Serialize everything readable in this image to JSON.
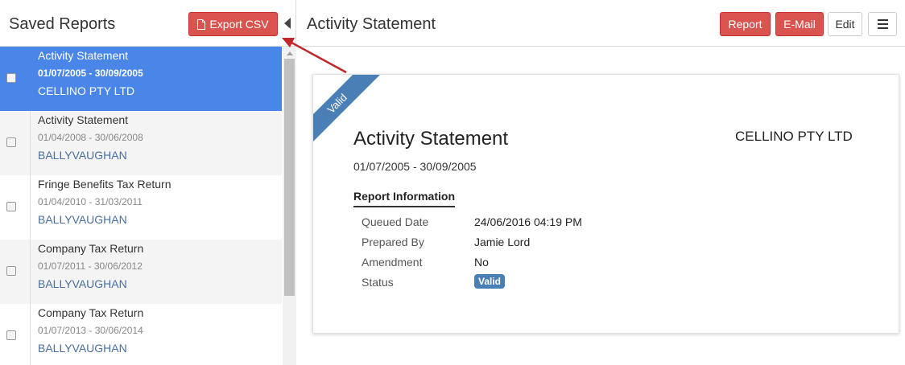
{
  "left_pane": {
    "title": "Saved Reports",
    "export_label": "Export CSV",
    "export_icon": "file-icon",
    "collapse_icon": "caret-left-icon"
  },
  "reports": [
    {
      "name": "Activity Statement",
      "period": "01/07/2005 - 30/09/2005",
      "entity": "CELLINO PTY LTD",
      "selected": true
    },
    {
      "name": "Activity Statement",
      "period": "01/04/2008 - 30/06/2008",
      "entity": "BALLYVAUGHAN",
      "selected": false
    },
    {
      "name": "Fringe Benefits Tax Return",
      "period": "01/04/2010 - 31/03/2011",
      "entity": "BALLYVAUGHAN",
      "selected": false
    },
    {
      "name": "Company Tax Return",
      "period": "01/07/2011 - 30/06/2012",
      "entity": "BALLYVAUGHAN",
      "selected": false
    },
    {
      "name": "Company Tax Return",
      "period": "01/07/2013 - 30/06/2014",
      "entity": "BALLYVAUGHAN",
      "selected": false
    }
  ],
  "right_pane": {
    "title": "Activity Statement",
    "buttons": {
      "report": "Report",
      "email": "E-Mail",
      "edit": "Edit"
    },
    "menu_icon": "hamburger-icon"
  },
  "card": {
    "ribbon": "Valid",
    "title": "Activity Statement",
    "entity": "CELLINO PTY LTD",
    "period": "01/07/2005 - 30/09/2005",
    "section_title": "Report Information",
    "info": [
      {
        "label": "Queued Date",
        "value": "24/06/2016 04:19 PM"
      },
      {
        "label": "Prepared By",
        "value": "Jamie Lord"
      },
      {
        "label": "Amendment",
        "value": "No"
      },
      {
        "label": "Status",
        "value": "Valid"
      }
    ]
  },
  "colors": {
    "danger": "#d9534f",
    "selected_row": "#4a86e8",
    "status_blue": "#4a7fb5",
    "entity_link": "#4a6f9a",
    "annotation_arrow": "#c0282b"
  }
}
